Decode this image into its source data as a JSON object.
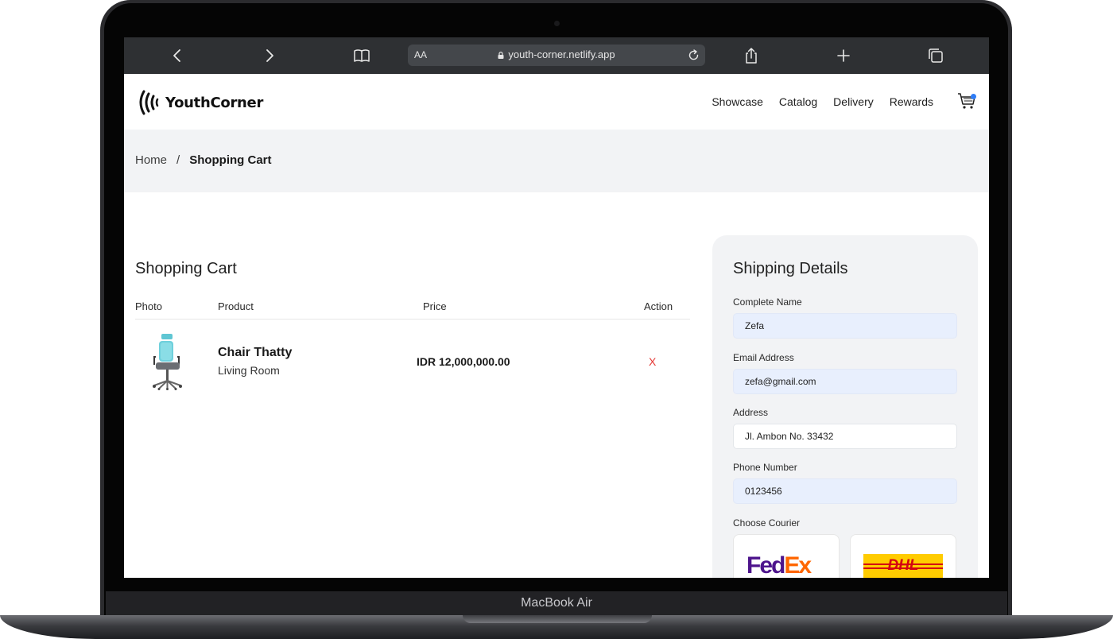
{
  "device": {
    "label": "MacBook Air"
  },
  "browser": {
    "text_size_label": "AA",
    "url": "youth-corner.netlify.app",
    "icons": [
      "back-icon",
      "forward-icon",
      "bookmarks-icon",
      "lock-icon",
      "reload-icon",
      "share-icon",
      "new-tab-icon",
      "tabs-icon"
    ]
  },
  "header": {
    "brand": "YouthCorner",
    "nav": [
      "Showcase",
      "Catalog",
      "Delivery",
      "Rewards"
    ],
    "cart_has_items": true,
    "accent_color": "#2e7cf6"
  },
  "breadcrumb": {
    "home": "Home",
    "separator": "/",
    "current": "Shopping Cart"
  },
  "cart": {
    "title": "Shopping Cart",
    "columns": {
      "photo": "Photo",
      "product": "Product",
      "price": "Price",
      "action": "Action"
    },
    "items": [
      {
        "name": "Chair Thatty",
        "category": "Living Room",
        "price": "IDR 12,000,000.00",
        "remove_label": "X"
      }
    ]
  },
  "shipping": {
    "title": "Shipping Details",
    "fields": {
      "name": {
        "label": "Complete Name",
        "value": "Zefa"
      },
      "email": {
        "label": "Email Address",
        "value": "zefa@gmail.com"
      },
      "address": {
        "label": "Address",
        "value": "Jl. Ambon No. 33432"
      },
      "phone": {
        "label": "Phone Number",
        "value": "0123456"
      }
    },
    "courier_label": "Choose Courier",
    "couriers": [
      "FedEx",
      "DHL"
    ],
    "fedex": {
      "fed": "Fed",
      "ex": "Ex"
    },
    "dhl_text": "DHL"
  }
}
